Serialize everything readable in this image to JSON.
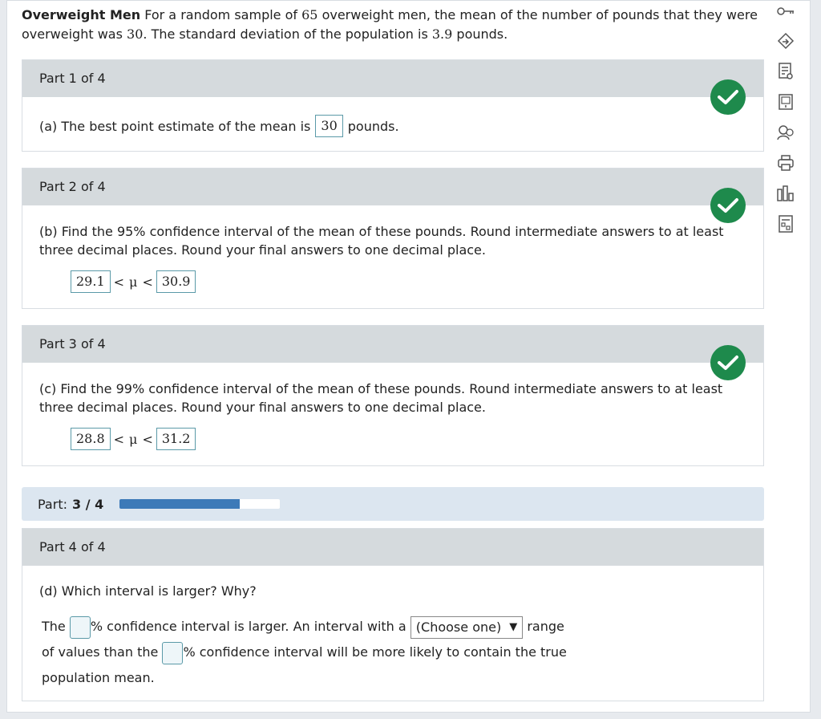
{
  "problem": {
    "title": "Overweight Men",
    "text_1": "For a random sample of",
    "n": "65",
    "text_2": "overweight men, the mean of the number of pounds that they were overweight was",
    "mean": "30",
    "text_3": ". The standard deviation of the population is",
    "sd": "3.9",
    "text_4": "pounds."
  },
  "parts": [
    {
      "header": "Part 1 of 4",
      "prompt_before": "(a) The best point estimate of the mean is",
      "answer": "30",
      "prompt_after": "pounds."
    },
    {
      "header": "Part 2 of 4",
      "prompt": "(b) Find the 95% confidence interval of the mean of these pounds. Round intermediate answers to at least three decimal places. Round your final answers to one decimal place.",
      "lower": "29.1",
      "upper": "30.9",
      "lt": "<",
      "mu": "μ"
    },
    {
      "header": "Part 3 of 4",
      "prompt": "(c) Find the 99% confidence interval of the mean of these pounds. Round intermediate answers to at least three decimal places. Round your final answers to one decimal place.",
      "lower": "28.8",
      "upper": "31.2",
      "lt": "<",
      "mu": "μ"
    },
    {
      "header": "Part 4 of 4",
      "question": "(d) Which interval is larger? Why?",
      "s1": "The",
      "s2": "% confidence interval is larger. An interval with a",
      "select": "(Choose one)",
      "select_arrow": "▼",
      "s3": "range",
      "s4": "of values than the",
      "s5": "% confidence interval will be more likely to contain the true",
      "s6": "population mean."
    }
  ],
  "progress": {
    "label": "Part:",
    "value": "3 / 4",
    "fraction": 0.75
  },
  "colors": {
    "check_green": "#1e8a4c",
    "progress_fill": "#3d7ab8",
    "header_gray": "#d5dadd"
  },
  "toolbar": [
    "key-icon",
    "diamond-arrow-icon",
    "document-search-icon",
    "ebook-icon",
    "ask-instructor-icon",
    "print-icon",
    "bar-chart-icon",
    "calculator-doc-icon"
  ]
}
